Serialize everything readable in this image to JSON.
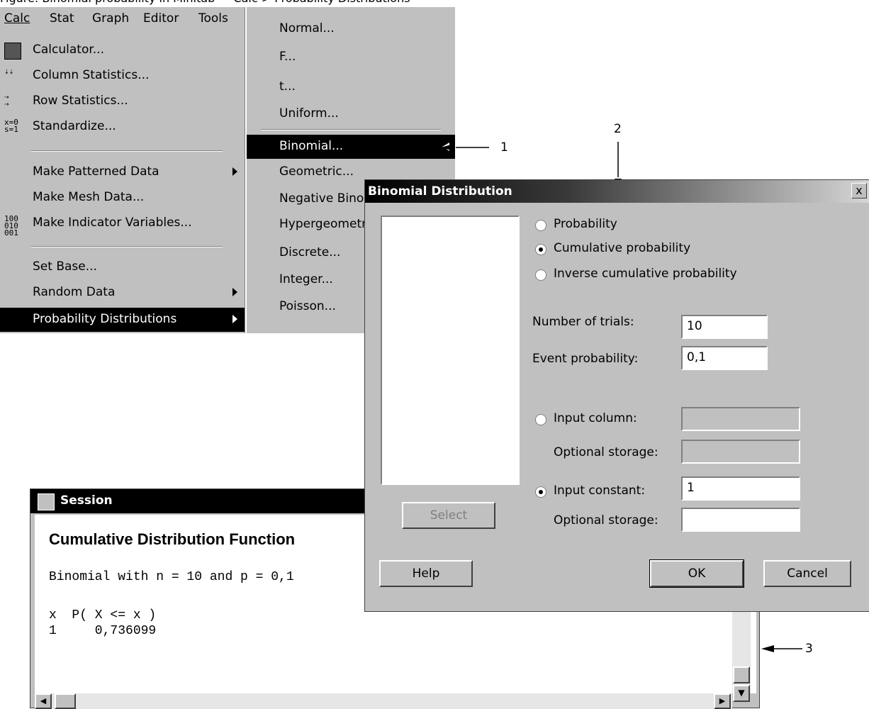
{
  "caption": "Figure: Binomial probability in Minitab — Calc > Probability Distributions",
  "menubar": [
    {
      "label": "Calc",
      "key": "C"
    },
    {
      "label": "Stat",
      "key": "S"
    },
    {
      "label": "Graph",
      "key": "G"
    },
    {
      "label": "Editor",
      "key": "d"
    },
    {
      "label": "Tools",
      "key": "T"
    }
  ],
  "calc_menu": {
    "calculator": "Calculator...",
    "column_statistics": "Column Statistics...",
    "row_statistics": "Row Statistics...",
    "standardize": "Standardize...",
    "make_patterned_data": "Make Patterned Data",
    "make_mesh_data": "Make Mesh Data...",
    "make_indicator_variables": "Make Indicator Variables...",
    "set_base": "Set Base...",
    "random_data": "Random Data",
    "probability_distributions": "Probability Distributions"
  },
  "prob_submenu": {
    "normal": "Normal...",
    "f": "F...",
    "t": "t...",
    "uniform": "Uniform...",
    "binomial": "Binomial...",
    "geometric": "Geometric...",
    "negative_binomial": "Negative Binomial...",
    "hypergeometric": "Hypergeometric...",
    "discrete": "Discrete...",
    "integer": "Integer...",
    "poisson": "Poisson..."
  },
  "callouts": {
    "one": "1",
    "two": "2",
    "three": "3"
  },
  "dialog": {
    "title": "Binomial Distribution",
    "close": "x",
    "radio_probability": "Probability",
    "radio_cumulative": "Cumulative probability",
    "radio_inverse": "Inverse cumulative probability",
    "selected_mode": "cumulative",
    "trials_label": "Number of trials:",
    "trials_value": "10",
    "event_label": "Event probability:",
    "event_value": "0,1",
    "input_column_label": "Input column:",
    "optional_storage_1": "Optional storage:",
    "input_constant_label": "Input constant:",
    "input_constant_value": "1",
    "optional_storage_2": "Optional storage:",
    "select_button": "Select",
    "help_button": "Help",
    "ok_button": "OK",
    "cancel_button": "Cancel"
  },
  "session": {
    "title": "Session",
    "heading": "Cumulative Distribution Function",
    "line1": "Binomial with n = 10 and p = 0,1",
    "header_row": "x  P( X <= x )",
    "data_row": "1     0,736099"
  }
}
